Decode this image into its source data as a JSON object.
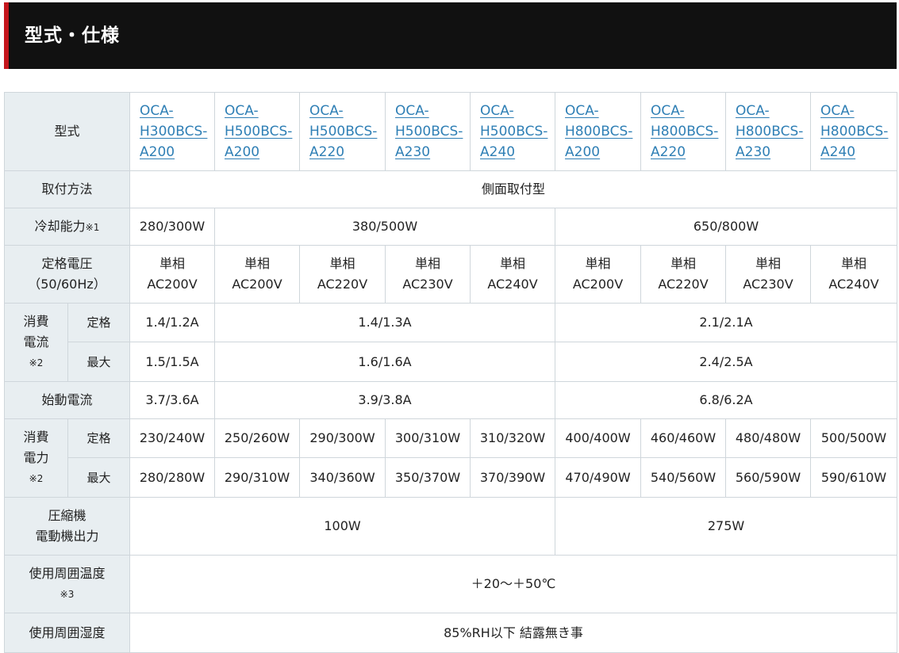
{
  "header": {
    "title": "型式・仕様",
    "accent_color": "#c4161c",
    "background_color": "#111111"
  },
  "table": {
    "row_labels": {
      "model": "型式",
      "mounting": "取付方法",
      "cooling": "冷却能力",
      "cooling_note": "※1",
      "voltage_line1": "定格電圧",
      "voltage_line2": "（50/60Hz）",
      "current_line1": "消費",
      "current_line2": "電流",
      "current_note": "※2",
      "rated": "定格",
      "max": "最大",
      "starting": "始動電流",
      "power_line1": "消費",
      "power_line2": "電力",
      "power_note": "※2",
      "compressor_line1": "圧縮機",
      "compressor_line2": "電動機出力",
      "temp": "使用周囲温度",
      "temp_note": "※3",
      "humidity": "使用周囲湿度"
    },
    "models": [
      {
        "l1": "OCA-",
        "l2": "H300BCS-",
        "l3": "A200"
      },
      {
        "l1": "OCA-",
        "l2": "H500BCS-",
        "l3": "A200"
      },
      {
        "l1": "OCA-",
        "l2": "H500BCS-",
        "l3": "A220"
      },
      {
        "l1": "OCA-",
        "l2": "H500BCS-",
        "l3": "A230"
      },
      {
        "l1": "OCA-",
        "l2": "H500BCS-",
        "l3": "A240"
      },
      {
        "l1": "OCA-",
        "l2": "H800BCS-",
        "l3": "A200"
      },
      {
        "l1": "OCA-",
        "l2": "H800BCS-",
        "l3": "A220"
      },
      {
        "l1": "OCA-",
        "l2": "H800BCS-",
        "l3": "A230"
      },
      {
        "l1": "OCA-",
        "l2": "H800BCS-",
        "l3": "A240"
      }
    ],
    "mounting": "側面取付型",
    "cooling": [
      "280/300W",
      "380/500W",
      "650/800W"
    ],
    "voltage": [
      {
        "l1": "単相",
        "l2": "AC200V"
      },
      {
        "l1": "単相",
        "l2": "AC200V"
      },
      {
        "l1": "単相",
        "l2": "AC220V"
      },
      {
        "l1": "単相",
        "l2": "AC230V"
      },
      {
        "l1": "単相",
        "l2": "AC240V"
      },
      {
        "l1": "単相",
        "l2": "AC200V"
      },
      {
        "l1": "単相",
        "l2": "AC220V"
      },
      {
        "l1": "単相",
        "l2": "AC230V"
      },
      {
        "l1": "単相",
        "l2": "AC240V"
      }
    ],
    "current_rated": [
      "1.4/1.2A",
      "1.4/1.3A",
      "2.1/2.1A"
    ],
    "current_max": [
      "1.5/1.5A",
      "1.6/1.6A",
      "2.4/2.5A"
    ],
    "starting_current": [
      "3.7/3.6A",
      "3.9/3.8A",
      "6.8/6.2A"
    ],
    "power_rated": [
      "230/240W",
      "250/260W",
      "290/300W",
      "300/310W",
      "310/320W",
      "400/400W",
      "460/460W",
      "480/480W",
      "500/500W"
    ],
    "power_max": [
      "280/280W",
      "290/310W",
      "340/360W",
      "350/370W",
      "370/390W",
      "470/490W",
      "540/560W",
      "560/590W",
      "590/610W"
    ],
    "compressor": [
      "100W",
      "275W"
    ],
    "temperature": "＋20～＋50℃",
    "humidity": "85%RH以下 結露無き事"
  }
}
